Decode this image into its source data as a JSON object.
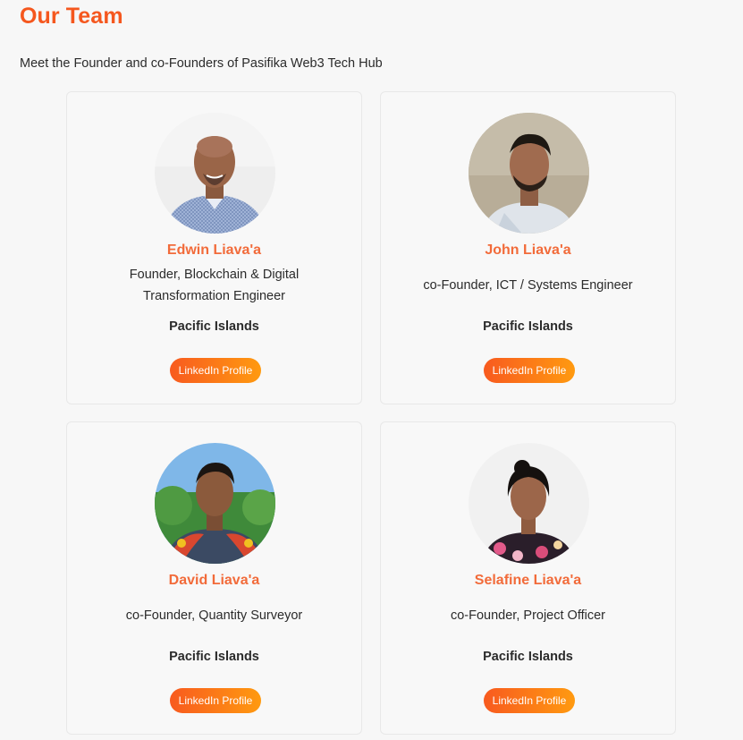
{
  "header": {
    "title": "Our Team",
    "subtitle": "Meet the Founder and co-Founders of Pasifika Web3 Tech Hub"
  },
  "team": [
    {
      "name": "Edwin Liava'a",
      "role": "Founder, Blockchain & Digital Transformation Engineer",
      "location": "Pacific Islands",
      "link_label": "LinkedIn Profile"
    },
    {
      "name": "John Liava'a",
      "role": "co-Founder, ICT / Systems Engineer",
      "location": "Pacific Islands",
      "link_label": "LinkedIn Profile"
    },
    {
      "name": "David Liava'a",
      "role": "co-Founder, Quantity Surveyor",
      "location": "Pacific Islands",
      "link_label": "LinkedIn Profile"
    },
    {
      "name": "Selafine Liava'a",
      "role": "co-Founder, Project Officer",
      "location": "Pacific Islands",
      "link_label": "LinkedIn Profile"
    }
  ],
  "colors": {
    "accent": "#f5571e",
    "name": "#f26b3a",
    "button_start": "#f85a1f",
    "button_end": "#ff9a10"
  }
}
